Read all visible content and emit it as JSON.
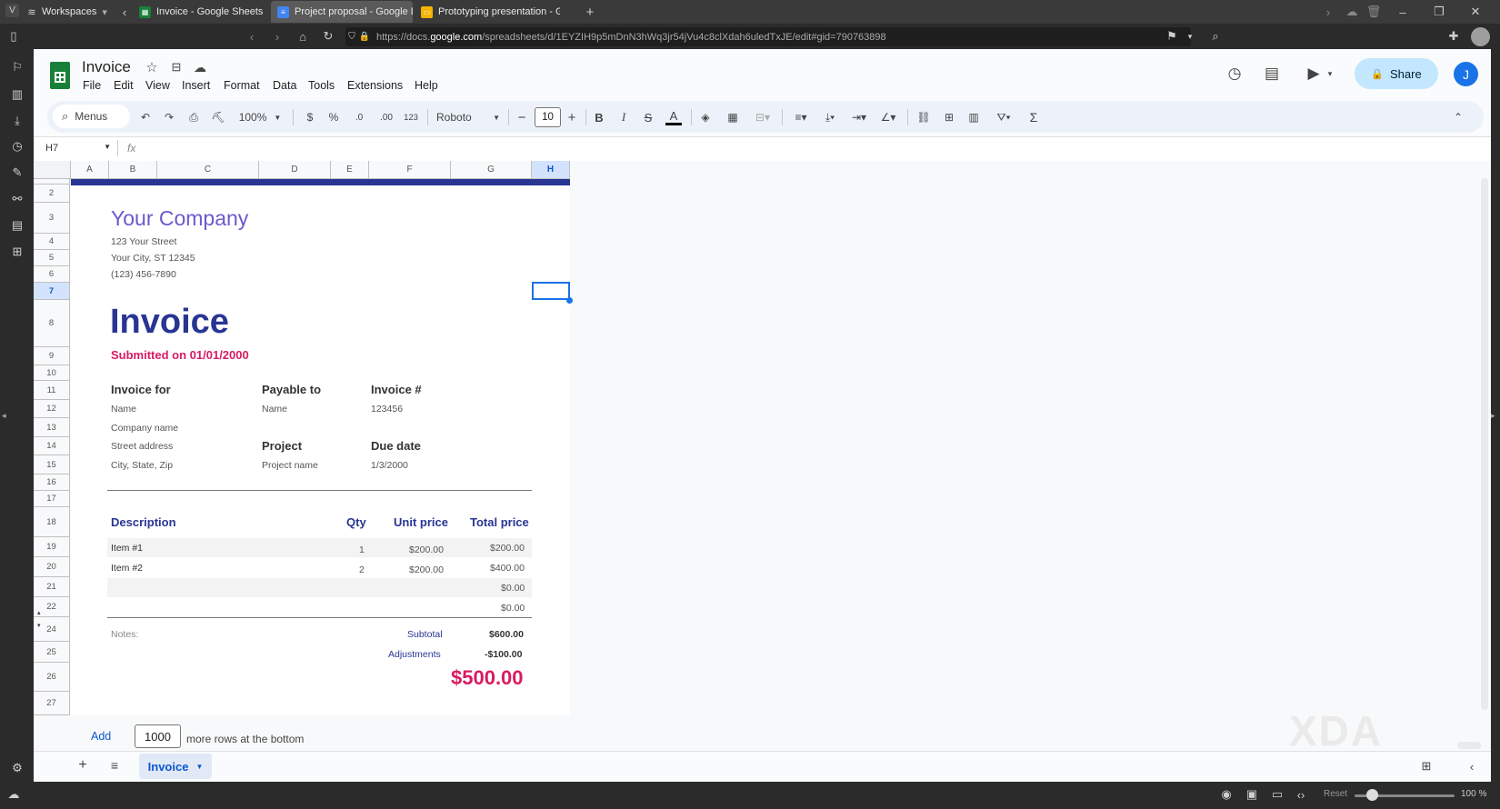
{
  "browser": {
    "tabs": [
      {
        "label": "Workspaces"
      },
      {
        "label": "Invoice - Google Sheets"
      },
      {
        "label": "Project proposal - Google Do"
      },
      {
        "label": "Prototyping presentation - G"
      }
    ],
    "url_prefix": "https://docs.",
    "url_domain": "google.com",
    "url_rest": "/spreadsheets/d/1EYZIH9p5mDnN3hWq3jr54jVu4c8clXdah6uledTxJE/edit#gid=790763898"
  },
  "app": {
    "title": "Invoice",
    "menus": [
      "File",
      "Edit",
      "View",
      "Insert",
      "Format",
      "Data",
      "Tools",
      "Extensions",
      "Help"
    ],
    "share_label": "Share",
    "avatar_initial": "J"
  },
  "toolbar": {
    "menus_search": "Menus",
    "zoom": "100%",
    "currency": "$",
    "percent": "%",
    "dec_decrease": ".0",
    "dec_increase": ".00",
    "number_format": "123",
    "font": "Roboto",
    "font_size": "10",
    "bold": "B",
    "italic": "I",
    "strike": "S",
    "text_color": "A"
  },
  "formula": {
    "cell_ref": "H7",
    "fx": "fx"
  },
  "columns": [
    "A",
    "B",
    "C",
    "D",
    "E",
    "F",
    "G",
    "H"
  ],
  "rows": [
    "2",
    "3",
    "4",
    "5",
    "6",
    "7",
    "8",
    "9",
    "10",
    "11",
    "12",
    "13",
    "14",
    "15",
    "16",
    "17",
    "18",
    "19",
    "20",
    "21",
    "22",
    "24",
    "25",
    "26",
    "27"
  ],
  "invoice": {
    "company": "Your Company",
    "street": "123 Your Street",
    "city": "Your City, ST 12345",
    "phone": "(123) 456-7890",
    "heading": "Invoice",
    "submitted": "Submitted on 01/01/2000",
    "invoice_for_label": "Invoice for",
    "invoice_for_name": "Name",
    "invoice_for_company": "Company name",
    "invoice_for_street": "Street address",
    "invoice_for_city": "City, State, Zip",
    "payable_label": "Payable to",
    "payable_name": "Name",
    "invoice_num_label": "Invoice #",
    "invoice_num": "123456",
    "project_label": "Project",
    "project_name": "Project name",
    "due_label": "Due date",
    "due_date": "1/3/2000",
    "table_headers": {
      "description": "Description",
      "qty": "Qty",
      "unit": "Unit price",
      "total": "Total price"
    },
    "items": [
      {
        "desc": "Item #1",
        "qty": "1",
        "unit": "$200.00",
        "total": "$200.00"
      },
      {
        "desc": "Item #2",
        "qty": "2",
        "unit": "$200.00",
        "total": "$400.00"
      },
      {
        "desc": "",
        "qty": "",
        "unit": "",
        "total": "$0.00"
      },
      {
        "desc": "",
        "qty": "",
        "unit": "",
        "total": "$0.00"
      }
    ],
    "notes_label": "Notes:",
    "subtotal_label": "Subtotal",
    "subtotal": "$600.00",
    "adjust_label": "Adjustments",
    "adjust": "-$100.00",
    "grand_total": "$500.00"
  },
  "add_rows": {
    "add_label": "Add",
    "count": "1000",
    "suffix": "more rows at the bottom"
  },
  "sheet_tab": "Invoice",
  "status": {
    "reset": "Reset",
    "zoom": "100 %"
  },
  "watermark": "XDA",
  "colors": {
    "accent_navy": "#283593",
    "company_purple": "#6a5acd",
    "pink": "#d81b60",
    "share_bg": "#c2e7ff"
  }
}
